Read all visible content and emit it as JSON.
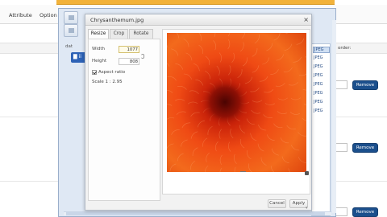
{
  "page": {
    "tabs": [
      {
        "label": "Attribute"
      },
      {
        "label": "Option"
      }
    ],
    "order_label": "order:",
    "remove_label": "Remove",
    "colors": {
      "remove_button": "#1b4f8c",
      "top_bar": "#f2b23a"
    }
  },
  "file_manager": {
    "tree_root_label": "dat",
    "tree_selected_label": "ii",
    "files": [
      "JPEG",
      "JPEG",
      "JPEG",
      "JPEG",
      "JPEG",
      "JPEG",
      "JPEG",
      "JPEG"
    ],
    "selected_color": "#2d62b6"
  },
  "dialog": {
    "title": "Chrysanthemum.jpg",
    "close_glyph": "×",
    "tabs": [
      {
        "label": "Resize",
        "active": true
      },
      {
        "label": "Crop",
        "active": false
      },
      {
        "label": "Rotate",
        "active": false
      }
    ],
    "resize": {
      "width_label": "Width",
      "width_value": "1077",
      "height_label": "Height",
      "height_value": "808",
      "aspect_label": "Aspect ratio",
      "aspect_checked": true,
      "scale_text": "Scale 1 : 2.95"
    },
    "cancel_label": "Cancel",
    "apply_label": "Apply",
    "scroll_glyph": "▾",
    "image_subject": "orange chrysanthemum flower"
  }
}
